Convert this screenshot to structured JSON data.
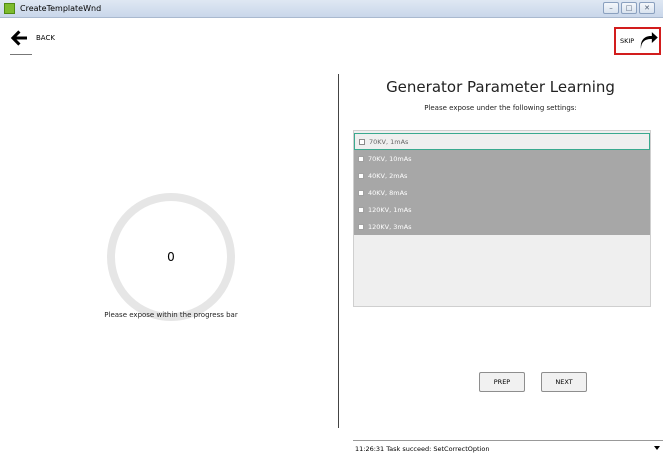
{
  "window": {
    "title": "CreateTemplateWnd"
  },
  "nav": {
    "back_label": "BACK",
    "skip_label": "SKIP"
  },
  "left": {
    "counter": "0",
    "instruction": "Please expose within the progress bar"
  },
  "right": {
    "heading": "Generator Parameter Learning",
    "subheading": "Please expose under the following settings:",
    "settings": [
      {
        "label": "70KV, 1mAs",
        "selected": true
      },
      {
        "label": "70KV, 10mAs",
        "selected": false
      },
      {
        "label": "40KV, 2mAs",
        "selected": false
      },
      {
        "label": "40KV, 8mAs",
        "selected": false
      },
      {
        "label": "120KV, 1mAs",
        "selected": false
      },
      {
        "label": "120KV, 3mAs",
        "selected": false
      }
    ],
    "prep_label": "PREP",
    "next_label": "NEXT"
  },
  "status": {
    "message": "11:26:31 Task succeed: SetCorrectOption"
  },
  "colors": {
    "selected_border": "#3aa98f",
    "skip_highlight": "#d21d1d",
    "disabled_row": "#a7a7a7"
  },
  "icons": {
    "back": "arrow-left-icon",
    "skip": "curved-arrow-right-icon",
    "app": "app-icon"
  }
}
